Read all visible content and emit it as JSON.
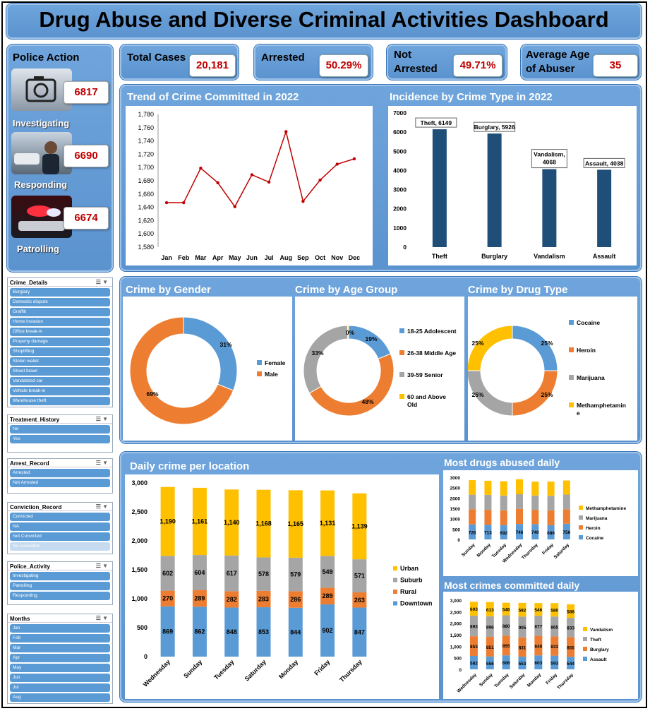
{
  "title": "Drug Abuse and Diverse Criminal Activities Dashboard",
  "kpis": {
    "total_label": "Total Cases",
    "total": "20,181",
    "arrested_label": "Arrested",
    "arrested": "50.29%",
    "not_arrested_label1": "Not",
    "not_arrested_label2": "Arrested",
    "not_arrested": "49.71%",
    "age_label1": "Average Age",
    "age_label2": "of Abuser",
    "age": "35"
  },
  "police": {
    "title": "Police Action",
    "items": [
      {
        "label": "Investigating",
        "value": "6817"
      },
      {
        "label": "Responding",
        "value": "6690"
      },
      {
        "label": "Patrolling",
        "value": "6674"
      }
    ]
  },
  "slicers": {
    "crime": {
      "title": "Crime_Details",
      "items": [
        "Burglary",
        "Domestic dispute",
        "Graffiti",
        "Home invasion",
        "Office break-in",
        "Property damage",
        "Shoplifting",
        "Stolen wallet",
        "Street brawl",
        "Vandalized car",
        "Vehicle break-in",
        "Warehouse theft"
      ]
    },
    "treatment": {
      "title": "Treatment_History",
      "items": [
        "No",
        "Yes"
      ]
    },
    "arrest": {
      "title": "Arrest_Record",
      "items": [
        "Arrested",
        "Not Arrested"
      ]
    },
    "conviction": {
      "title": "Conviction_Record",
      "items": [
        "Convicted",
        "NA",
        "Not Convicted",
        "No conviction"
      ]
    },
    "police_activity": {
      "title": "Police_Activity",
      "items": [
        "Investigating",
        "Patrolling",
        "Responding"
      ]
    },
    "months": {
      "title": "Months",
      "items": [
        "Jan",
        "Feb",
        "Mar",
        "Apr",
        "May",
        "Jun",
        "Jul",
        "Aug"
      ]
    }
  },
  "chart_data": [
    {
      "id": "trend",
      "type": "line",
      "title": "Trend of Crime Committed in 2022",
      "categories": [
        "Jan",
        "Feb",
        "Mar",
        "Apr",
        "May",
        "Jun",
        "Jul",
        "Aug",
        "Sep",
        "Oct",
        "Nov",
        "Dec"
      ],
      "values": [
        1647,
        1647,
        1699,
        1677,
        1641,
        1689,
        1678,
        1754,
        1649,
        1681,
        1705,
        1713
      ],
      "ylim": [
        1580,
        1780
      ],
      "yticks": [
        "1,580",
        "1,600",
        "1,620",
        "1,640",
        "1,660",
        "1,680",
        "1,700",
        "1,720",
        "1,740",
        "1,760",
        "1,780"
      ],
      "color": "#c00000"
    },
    {
      "id": "crimetype",
      "type": "bar",
      "title": "Incidence by Crime Type in 2022",
      "categories": [
        "Theft",
        "Burglary",
        "Vandalism",
        "Assault"
      ],
      "values": [
        6149,
        5926,
        4068,
        4038
      ],
      "labels": [
        "Theft, 6149",
        "Burglary, 5926",
        "Vandalism,|4068",
        "Assault, 4038"
      ],
      "ylim": [
        0,
        7000
      ],
      "yticks": [
        "0",
        "1000",
        "2000",
        "3000",
        "4000",
        "5000",
        "6000",
        "7000"
      ],
      "color": "#1f4e79"
    },
    {
      "id": "gender",
      "type": "pie",
      "title": "Crime by Gender",
      "series": [
        {
          "name": "Female",
          "value": 31,
          "color": "#5b9bd5"
        },
        {
          "name": "Male",
          "value": 69,
          "color": "#ed7d31"
        }
      ],
      "labels": [
        "31%",
        "69%"
      ]
    },
    {
      "id": "age",
      "type": "pie",
      "title": "Crime by Age Group",
      "series": [
        {
          "name": "18-25 Adolescent",
          "value": 19,
          "color": "#5b9bd5"
        },
        {
          "name": "26-38 Middle Age",
          "value": 48,
          "color": "#ed7d31"
        },
        {
          "name": "39-59 Senior",
          "value": 33,
          "color": "#a5a5a5"
        },
        {
          "name": "60 and Above Old",
          "value": 0.4,
          "color": "#ffc000"
        }
      ],
      "labels": [
        "19%",
        "48%",
        "33%",
        "0%"
      ]
    },
    {
      "id": "drug",
      "type": "pie",
      "title": "Crime by Drug Type",
      "series": [
        {
          "name": "Cocaine",
          "value": 25,
          "color": "#5b9bd5"
        },
        {
          "name": "Heroin",
          "value": 25,
          "color": "#ed7d31"
        },
        {
          "name": "Marijuana",
          "value": 25,
          "color": "#a5a5a5"
        },
        {
          "name": "Methamphetamine",
          "value": 25,
          "color": "#ffc000"
        }
      ],
      "labels": [
        "25%",
        "25%",
        "25%",
        "25%"
      ]
    },
    {
      "id": "location",
      "type": "bar",
      "title": "Daily crime per location",
      "categories": [
        "Wednesday",
        "Sunday",
        "Tuesday",
        "Saturday",
        "Monday",
        "Friday",
        "Thursday"
      ],
      "ylim": [
        0,
        3000
      ],
      "yticks": [
        "0",
        "500",
        "1,000",
        "1,500",
        "2,000",
        "2,500",
        "3,000"
      ],
      "series": [
        {
          "name": "Downtown",
          "values": [
            869,
            862,
            848,
            853,
            844,
            902,
            847
          ],
          "color": "#5b9bd5"
        },
        {
          "name": "Rural",
          "values": [
            270,
            289,
            282,
            283,
            286,
            289,
            263
          ],
          "color": "#ed7d31"
        },
        {
          "name": "Suburb",
          "values": [
            602,
            604,
            617,
            578,
            579,
            549,
            571
          ],
          "color": "#a5a5a5"
        },
        {
          "name": "Urban",
          "values": [
            1190,
            1161,
            1140,
            1168,
            1165,
            1131,
            1139
          ],
          "color": "#ffc000"
        }
      ],
      "labels": [
        "1,190",
        "1,161",
        "1,140",
        "1,168",
        "1,165",
        "1,131",
        "1,139",
        "602",
        "604",
        "617",
        "578",
        "579",
        "549",
        "571",
        "270",
        "289",
        "282",
        "283",
        "286",
        "289",
        "263",
        "869",
        "862",
        "848",
        "853",
        "844",
        "902",
        "847"
      ]
    },
    {
      "id": "drugsdaily",
      "type": "bar",
      "title": "Most drugs abused daily",
      "categories": [
        "Sunday",
        "Monday",
        "Tuesday",
        "Wednesday",
        "Thursday",
        "Friday",
        "Saturday"
      ],
      "ylim": [
        0,
        3000
      ],
      "yticks": [
        "0",
        "500",
        "1000",
        "1500",
        "2000",
        "2500",
        "3000"
      ],
      "series": [
        {
          "name": "Cocaine",
          "values": [
            726,
            713,
            692,
            746,
            740,
            686,
            756
          ],
          "color": "#5b9bd5"
        },
        {
          "name": "Heroin",
          "values": [
            735,
            720,
            712,
            730,
            690,
            720,
            700
          ],
          "color": "#ed7d31"
        },
        {
          "name": "Marijuana",
          "values": [
            700,
            720,
            715,
            705,
            690,
            700,
            710
          ],
          "color": "#a5a5a5"
        },
        {
          "name": "Methamphetamine",
          "values": [
            700,
            680,
            690,
            725,
            670,
            690,
            680
          ],
          "color": "#ffc000"
        }
      ],
      "labels": [
        "726",
        "713",
        "692",
        "746",
        "740",
        "686",
        "756"
      ]
    },
    {
      "id": "crimesdaily",
      "type": "bar",
      "title": "Most crimes committed daily",
      "categories": [
        "Wednesday",
        "Sunday",
        "Tuesday",
        "Saturday",
        "Monday",
        "Friday",
        "Thursday"
      ],
      "ylim": [
        0,
        3000
      ],
      "yticks": [
        "0",
        "500",
        "1,000",
        "1,500",
        "2,000",
        "2,500",
        "3,000"
      ],
      "series": [
        {
          "name": "Assault",
          "values": [
            582,
            556,
            606,
            553,
            603,
            593,
            544
          ],
          "color": "#5b9bd5"
        },
        {
          "name": "Burglary",
          "values": [
            853,
            851,
            855,
            831,
            848,
            833,
            855
          ],
          "color": "#ed7d31"
        },
        {
          "name": "Theft",
          "values": [
            893,
            896,
            880,
            905,
            877,
            865,
            833
          ],
          "color": "#a5a5a5"
        },
        {
          "name": "Vandalism",
          "values": [
            603,
            613,
            546,
            592,
            546,
            580,
            588
          ],
          "color": "#ffc000"
        }
      ],
      "labels": [
        "603",
        "613",
        "546",
        "592",
        "546",
        "580",
        "588",
        "893",
        "896",
        "880",
        "905",
        "877",
        "865",
        "833",
        "853",
        "851",
        "855",
        "831",
        "848",
        "833",
        "855",
        "582",
        "556",
        "606",
        "553",
        "603",
        "593",
        "544"
      ]
    }
  ]
}
